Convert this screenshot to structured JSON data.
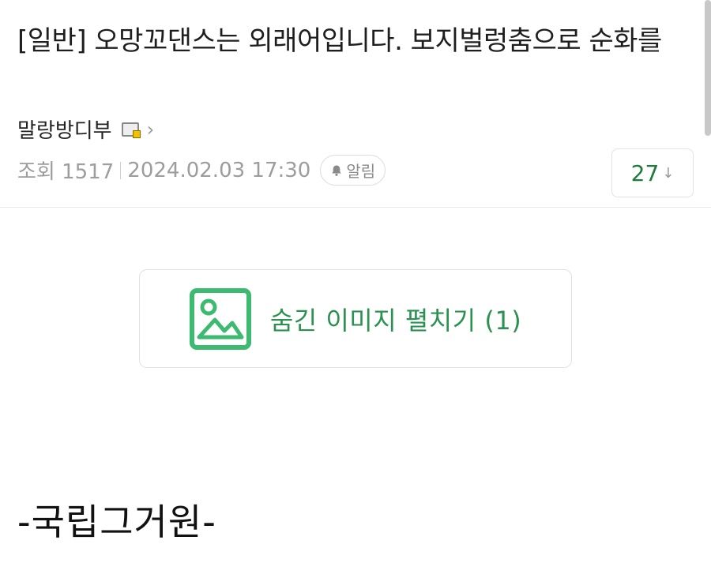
{
  "post": {
    "title": "[일반] 오망꼬댄스는 외래어입니다. 보지벌렁춤으로 순화를",
    "author": "말랑방디부",
    "views_label": "조회 1517",
    "datetime": "2024.02.03 17:30",
    "alarm_label": "알림",
    "comment_count": "27",
    "comment_arrow": "↓"
  },
  "hidden_image": {
    "label": "숨긴 이미지 펼치기 (1)",
    "icon": "image-icon",
    "accent_color": "#3cba6f"
  },
  "content": {
    "text": "-국립그거원-"
  },
  "icons": {
    "author_badge": "level-badge-icon",
    "author_chevron": "chevron-right-icon",
    "alarm": "bell-icon"
  }
}
